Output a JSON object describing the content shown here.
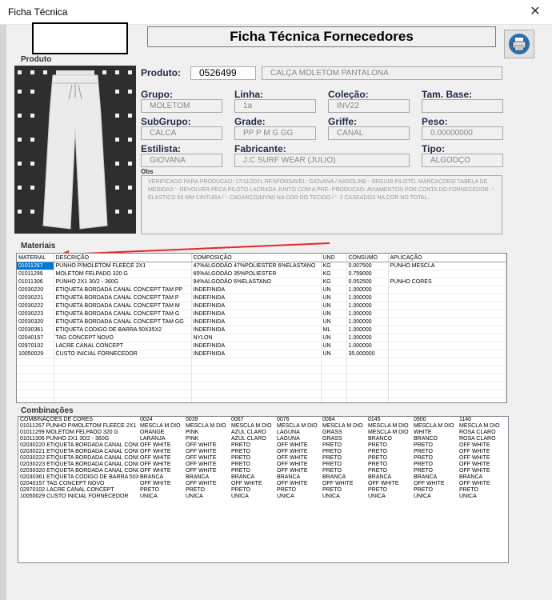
{
  "window": {
    "title": "Ficha Técnica",
    "close": "✕"
  },
  "header": {
    "title": "Ficha Técnica Fornecedores"
  },
  "photo_label": "Produto",
  "product": {
    "label": "Produto:",
    "code": "0526499",
    "name": "CALÇA MOLETOM PANTALONA"
  },
  "fields": {
    "grupo": {
      "label": "Grupo:",
      "value": "MOLETOM"
    },
    "linha": {
      "label": "Linha:",
      "value": "1a"
    },
    "colecao": {
      "label": "Coleção:",
      "value": "INV22"
    },
    "tambase": {
      "label": "Tam. Base:",
      "value": ""
    },
    "subgrupo": {
      "label": "SubGrupo:",
      "value": "CALCA"
    },
    "grade": {
      "label": "Grade:",
      "value": "PP P M G GG"
    },
    "griffe": {
      "label": "Griffe:",
      "value": "CANAL"
    },
    "peso": {
      "label": "Peso:",
      "value": "0.00000000"
    },
    "estilista": {
      "label": "Estilista:",
      "value": "GIOVANA"
    },
    "fabricante": {
      "label": "Fabricante:",
      "value": "J.C SURF WEAR (JULIO)"
    },
    "tipo": {
      "label": "Tipo:",
      "value": "ALGODÇO"
    }
  },
  "obs": {
    "label": "Obs",
    "text": "VERIFICADO PARA PRODUCAO: 17/11/2021 RESPONSAVEL: GIOVANA / KAROLINE - SEGUIR PILOTO, MARCACOES/ TABELA DE MEDIDAS '- DEVOLVER PECA PILOTO LACRADA JUNTO COM A PRE- PRODUCAO. AVIAMENTOS POR CONTA DO FORNECEDOR: '- ELASTICO 55 MM CINTURA / '- CADARCO(MVW) NA COR DO TECIDO / '- 2 CASEADOS NA COR NO TOTAL."
  },
  "materiais": {
    "label": "Materiais",
    "columns": [
      "MATERIAL",
      "DESCRIÇÃO",
      "COMPOSIÇÃO",
      "UND",
      "CONSUMO",
      "APLICAÇÃO"
    ],
    "rows": [
      [
        "01011267",
        "PUNHO P/MOLETOM FLEECE 2X1",
        "47%ALGODÃO 47%POLIESTER 6%ELASTANO",
        "KG",
        "0.007500",
        "PUNHO MESCLA"
      ],
      [
        "01011299",
        "MOLETOM FELPADO 320 G",
        "65%ALGODÃO 35%POLIESTER",
        "KG",
        "0.759000",
        ""
      ],
      [
        "01011306",
        "PUNHO 2X1 30/2 - 360G",
        "94%ALGODÃO 6%ELASTANO",
        "KG",
        "0.052500",
        "PUNHO CORES"
      ],
      [
        "02030220",
        "ETIQUETA BORDADA CANAL CONCEPT TAM PP",
        "INDEFINIDA",
        "UN",
        "1.000000",
        ""
      ],
      [
        "02030221",
        "ETIQUETA BORDADA CANAL CONCEPT TAM P",
        "INDEFINIDA",
        "UN",
        "1.000000",
        ""
      ],
      [
        "02030222",
        "ETIQUETA BORDADA CANAL CONCEPT TAM M",
        "INDEFINIDA",
        "UN",
        "1.000000",
        ""
      ],
      [
        "02030223",
        "ETIQUETA BORDADA CANAL CONCEPT TAM G",
        "INDEFINIDA",
        "UN",
        "1.000000",
        ""
      ],
      [
        "02030320",
        "ETIQUETA BORDADA CANAL CONCEPT TAM GG",
        "INDEFINIDA",
        "UN",
        "1.000000",
        ""
      ],
      [
        "02030361",
        "ETIQUETA CODIGO DE BARRA 50X35X2",
        "INDEFINIDA",
        "ML",
        "1.000000",
        ""
      ],
      [
        "02040157",
        "TAG CONCEPT NOVO",
        "NYLON",
        "UN",
        "1.000000",
        ""
      ],
      [
        "02970102",
        "LACRE CANAL CONCEPT",
        "INDEFINIDA",
        "UN",
        "1.000000",
        ""
      ],
      [
        "10050029",
        "CUSTO INICIAL FORNECEDOR",
        "INDEFINIDA",
        "UN",
        "35.000000",
        ""
      ]
    ]
  },
  "combinacoes": {
    "label": "Combinações",
    "header": [
      "COMBINAÇÕES DE CORES",
      "0024",
      "0039",
      "0067",
      "0076",
      "0084",
      "0145",
      "0900",
      "1140"
    ],
    "rows": [
      [
        "01011267 PUNHO P/MOLETOM FLEECE 2X1",
        "MESCLA M DIO",
        "MESCLA M DIO",
        "MESCLA M DIO",
        "MESCLA M DIO",
        "MESCLA M DIO",
        "MESCLA M DIO",
        "MESCLA M DIO",
        "MESCLA M DIO"
      ],
      [
        "01011299 MOLETOM FELPADO 320 G",
        "ORANGE",
        "PINK",
        "AZUL CLARO",
        "LAGUNA",
        "GRASS",
        "MESCLA M DIO",
        "WHITE",
        "ROSA CLARO"
      ],
      [
        "01011306 PUNHO 2X1 30/2 - 360G",
        "LARANJA",
        "PINK",
        "AZUL CLARO",
        "LAGUNA",
        "GRASS",
        "BRANCO",
        "BRANCO",
        "ROSA CLARO"
      ],
      [
        "02030220 ETIQUETA BORDADA CANAL CONC",
        "OFF WHITE",
        "OFF WHITE",
        "PRETO",
        "OFF WHITE",
        "PRETO",
        "PRETO",
        "PRETO",
        "OFF WHITE"
      ],
      [
        "02030221 ETIQUETA BORDADA CANAL CONC",
        "OFF WHITE",
        "OFF WHITE",
        "PRETO",
        "OFF WHITE",
        "PRETO",
        "PRETO",
        "PRETO",
        "OFF WHITE"
      ],
      [
        "02030222 ETIQUETA BORDADA CANAL CONC",
        "OFF WHITE",
        "OFF WHITE",
        "PRETO",
        "OFF WHITE",
        "PRETO",
        "PRETO",
        "PRETO",
        "OFF WHITE"
      ],
      [
        "02030223 ETIQUETA BORDADA CANAL CONC",
        "OFF WHITE",
        "OFF WHITE",
        "PRETO",
        "OFF WHITE",
        "PRETO",
        "PRETO",
        "PRETO",
        "OFF WHITE"
      ],
      [
        "02030320 ETIQUETA BORDADA CANAL CONC",
        "OFF WHITE",
        "OFF WHITE",
        "PRETO",
        "OFF WHITE",
        "PRETO",
        "PRETO",
        "PRETO",
        "OFF WHITE"
      ],
      [
        "02030361 ETIQUETA CODIGO DE BARRA 50X",
        "BRANCA",
        "BRANCA",
        "BRANCA",
        "BRANCA",
        "BRANCA",
        "BRANCA",
        "BRANCA",
        "BRANCA"
      ],
      [
        "02040157 TAG CONCEPT NOVO",
        "OFF WHITE",
        "OFF WHITE",
        "OFF WHITE",
        "OFF WHITE",
        "OFF WHITE",
        "OFF WHITE",
        "OFF WHITE",
        "OFF WHITE"
      ],
      [
        "02970102 LACRE CANAL CONCEPT",
        "PRETO",
        "PRETO",
        "PRETO",
        "PRETO",
        "PRETO",
        "PRETO",
        "PRETO",
        "PRETO"
      ],
      [
        "10050029 CUSTO INICIAL FORNECEDOR",
        "UNICA",
        "UNICA",
        "UNICA",
        "UNICA",
        "UNICA",
        "UNICA",
        "UNICA",
        "UNICA"
      ]
    ]
  },
  "icons": {
    "print": "printer-icon",
    "arrow": "red-arrow-annotation"
  },
  "colors": {
    "selection": "#0078d7",
    "arrow": "#e8262a",
    "label": "#1e2b4a"
  }
}
